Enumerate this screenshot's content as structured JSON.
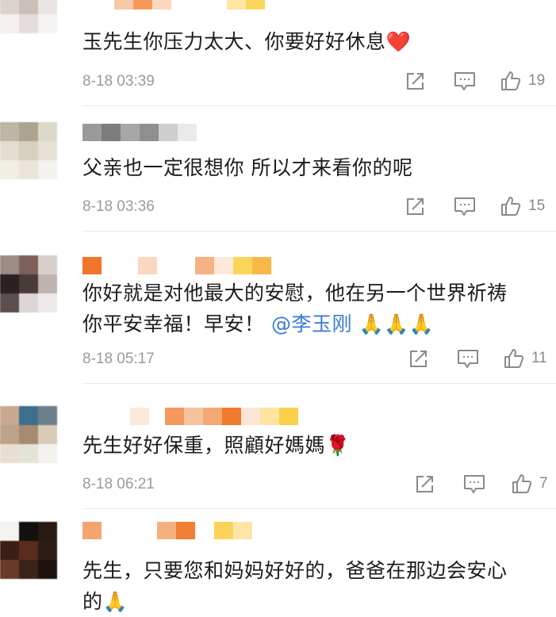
{
  "comments": [
    {
      "text": "玉先生你压力太大、你要好好休息",
      "emoji": "❤️",
      "time": "8-18 03:39",
      "likes": "19"
    },
    {
      "text": "父亲也一定很想你 所以才来看你的呢",
      "time": "8-18 03:36",
      "likes": "15"
    },
    {
      "text_line1": "你好就是对他最大的安慰，他在另一个世界祈祷",
      "text_line2": "你平安幸福！早安！",
      "mention": "@李玉刚",
      "emoji": "🙏🙏🙏",
      "time": "8-18 05:17",
      "likes": "11"
    },
    {
      "text": "先生好好保重，照顧好媽媽",
      "emoji": "🌹",
      "time": "8-18 06:21",
      "likes": "7"
    },
    {
      "text_line1": "先生，只要您和妈妈好好的，爸爸在那边会安心",
      "text_line2": "的",
      "emoji": "🙏"
    }
  ],
  "icons": {
    "share": "share-icon",
    "reply": "comment-icon",
    "like": "thumbs-up-icon"
  },
  "colors": {
    "mention": "#3a7bd5",
    "meta": "#9a9a9a",
    "heart": "#e0262e"
  }
}
